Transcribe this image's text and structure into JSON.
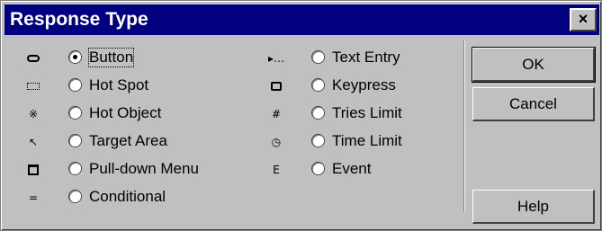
{
  "window": {
    "title": "Response Type",
    "close_glyph": "×"
  },
  "options_left": [
    {
      "label": "Button",
      "icon": "button-shape-icon",
      "checked": true
    },
    {
      "label": "Hot Spot",
      "icon": "hot-spot-icon",
      "checked": false
    },
    {
      "label": "Hot Object",
      "icon": "hot-object-icon",
      "checked": false
    },
    {
      "label": "Target Area",
      "icon": "target-area-icon",
      "checked": false
    },
    {
      "label": "Pull-down Menu",
      "icon": "pull-down-menu-icon",
      "checked": false
    },
    {
      "label": "Conditional",
      "icon": "conditional-icon",
      "checked": false
    }
  ],
  "options_right": [
    {
      "label": "Text Entry",
      "icon": "text-entry-icon",
      "checked": false
    },
    {
      "label": "Keypress",
      "icon": "keypress-icon",
      "checked": false
    },
    {
      "label": "Tries Limit",
      "icon": "tries-limit-icon",
      "checked": false
    },
    {
      "label": "Time Limit",
      "icon": "time-limit-icon",
      "checked": false
    },
    {
      "label": "Event",
      "icon": "event-icon",
      "checked": false
    }
  ],
  "icon_glyphs": {
    "hot_object": "※",
    "target_area": "↖",
    "conditional": "=",
    "text_entry": "▸…",
    "tries_limit": "#",
    "time_limit": "◷",
    "event": "E"
  },
  "buttons": {
    "ok": "OK",
    "cancel": "Cancel",
    "help": "Help"
  }
}
